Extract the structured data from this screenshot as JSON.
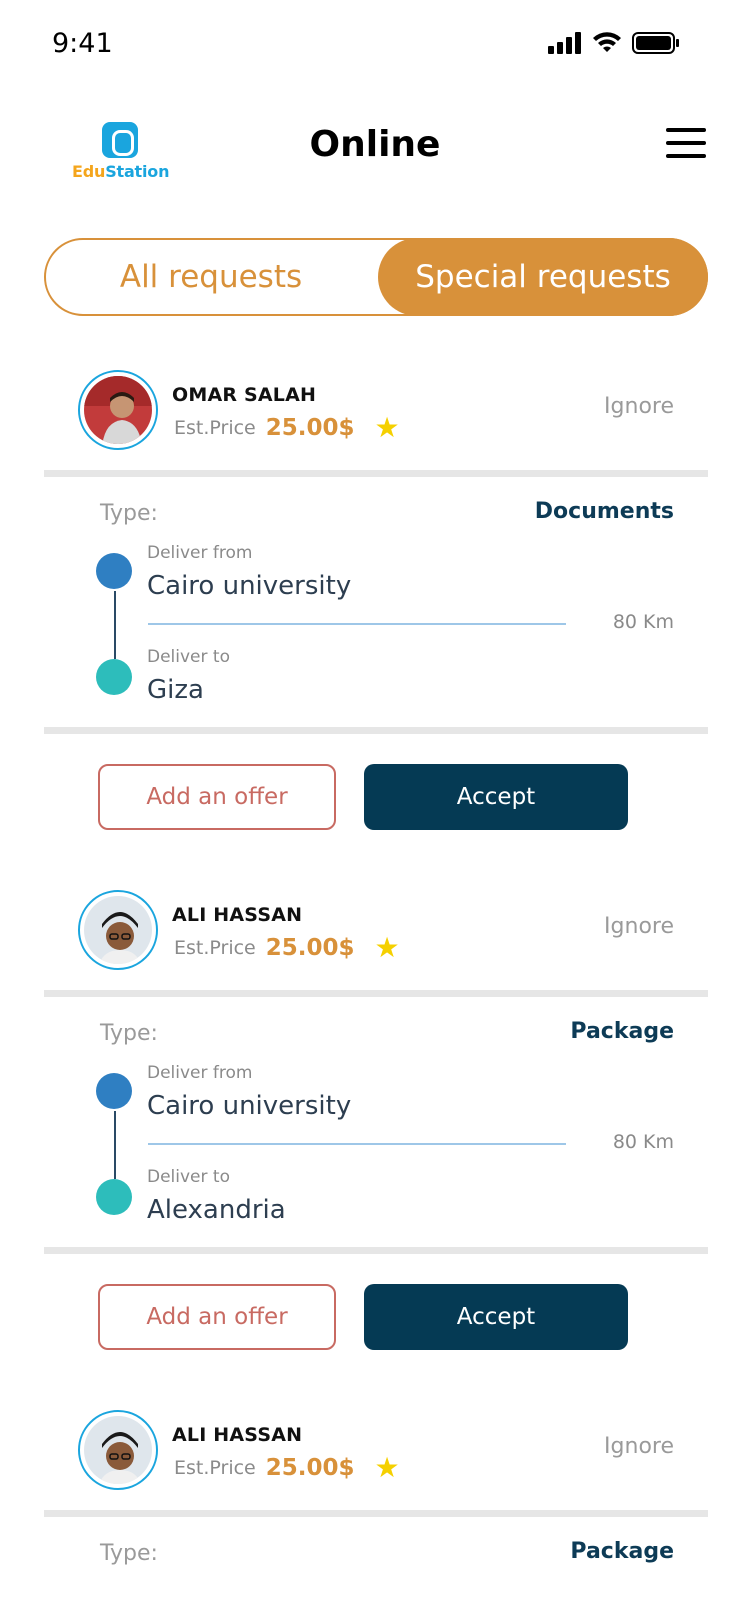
{
  "status_bar": {
    "time": "9:41"
  },
  "header": {
    "logo_part1": "Edu",
    "logo_part2": "Station",
    "title": "Online"
  },
  "tabs": [
    {
      "label": "All requests",
      "active": false
    },
    {
      "label": "Special requests",
      "active": true
    }
  ],
  "colors": {
    "accent": "#d8913a",
    "primary": "#053a54",
    "offer": "#c86a62",
    "from_dot": "#2f7fc2",
    "to_dot": "#2dbdbb"
  },
  "requests": [
    {
      "name": "OMAR SALAH",
      "est_label": "Est.Price",
      "price": "25.00$",
      "ignore_label": "Ignore",
      "type_label": "Type:",
      "type_value": "Documents",
      "from_label": "Deliver from",
      "from_value": "Cairo university",
      "distance": "80 Km",
      "to_label": "Deliver to",
      "to_value": "Giza",
      "offer_label": "Add an offer",
      "accept_label": "Accept"
    },
    {
      "name": "ALI HASSAN",
      "est_label": "Est.Price",
      "price": "25.00$",
      "ignore_label": "Ignore",
      "type_label": "Type:",
      "type_value": "Package",
      "from_label": "Deliver from",
      "from_value": "Cairo university",
      "distance": "80 Km",
      "to_label": "Deliver to",
      "to_value": "Alexandria",
      "offer_label": "Add an offer",
      "accept_label": "Accept"
    },
    {
      "name": "ALI HASSAN",
      "est_label": "Est.Price",
      "price": "25.00$",
      "ignore_label": "Ignore",
      "type_label": "Type:",
      "type_value": "Package"
    }
  ]
}
